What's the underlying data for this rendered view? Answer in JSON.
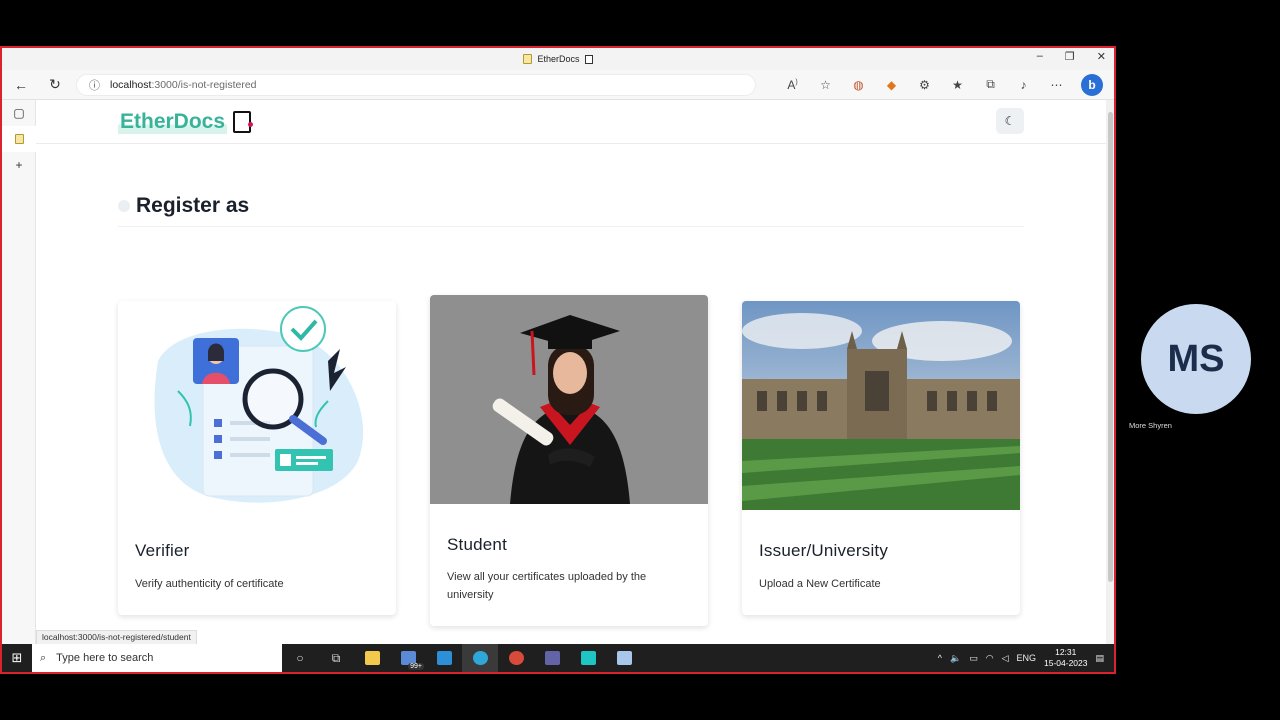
{
  "browser": {
    "tab_title": "EtherDocs",
    "url_host": "localhost",
    "url_path": ":3000/is-not-registered",
    "status_url": "localhost:3000/is-not-registered/student"
  },
  "app": {
    "logo": "EtherDocs",
    "section_title": "Register as",
    "brand_color": "#37b39a"
  },
  "cards": [
    {
      "title": "Verifier",
      "description": "Verify authenticity of certificate"
    },
    {
      "title": "Student",
      "description": "View all your certificates uploaded by the university"
    },
    {
      "title": "Issuer/University",
      "description": "Upload a New Certificate"
    }
  ],
  "taskbar": {
    "search_placeholder": "Type here to search",
    "badge": "99+",
    "lang": "ENG",
    "time": "12:31",
    "date": "15-04-2023"
  },
  "meeting": {
    "initials": "MS",
    "name": "More Shyren"
  }
}
